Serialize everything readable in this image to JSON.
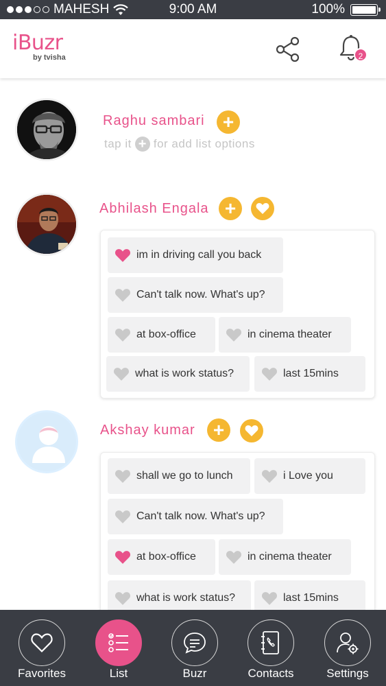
{
  "status_bar": {
    "carrier": "MAHESH",
    "time": "9:00 AM",
    "battery": "100%"
  },
  "header": {
    "logo": "iBuzr",
    "logo_sub": "by tvisha",
    "notification_count": "2"
  },
  "hint": {
    "prefix": "tap it",
    "suffix": "for add list options"
  },
  "contacts": [
    {
      "name": "Raghu sambari"
    },
    {
      "name": "Abhilash Engala",
      "messages": [
        {
          "text": "im in driving call you back",
          "favorite": true
        },
        {
          "text": "Can't talk now. What's up?",
          "favorite": false
        },
        {
          "text": "at box-office",
          "favorite": false
        },
        {
          "text": "in cinema theater",
          "favorite": false
        },
        {
          "text": "what is work status?",
          "favorite": false
        },
        {
          "text": "last 15mins",
          "favorite": false
        }
      ]
    },
    {
      "name": "Akshay kumar",
      "messages": [
        {
          "text": "shall we go to lunch",
          "favorite": false
        },
        {
          "text": "i Love you",
          "favorite": false
        },
        {
          "text": "Can't talk now. What's up?",
          "favorite": false
        },
        {
          "text": "at box-office",
          "favorite": true
        },
        {
          "text": "in cinema theater",
          "favorite": false
        },
        {
          "text": "what is work status?",
          "favorite": false
        },
        {
          "text": "last 15mins",
          "favorite": false
        }
      ]
    }
  ],
  "nav": [
    {
      "label": "Favorites",
      "icon": "heart-icon",
      "active": false
    },
    {
      "label": "List",
      "icon": "list-icon",
      "active": true
    },
    {
      "label": "Buzr",
      "icon": "chat-icon",
      "active": false
    },
    {
      "label": "Contacts",
      "icon": "phone-book-icon",
      "active": false
    },
    {
      "label": "Settings",
      "icon": "user-settings-icon",
      "active": false
    }
  ],
  "colors": {
    "brand_pink": "#e8528a",
    "accent_yellow": "#f5b731",
    "nav_bg": "#3a3d44",
    "chip_bg": "#f1f1f2"
  }
}
